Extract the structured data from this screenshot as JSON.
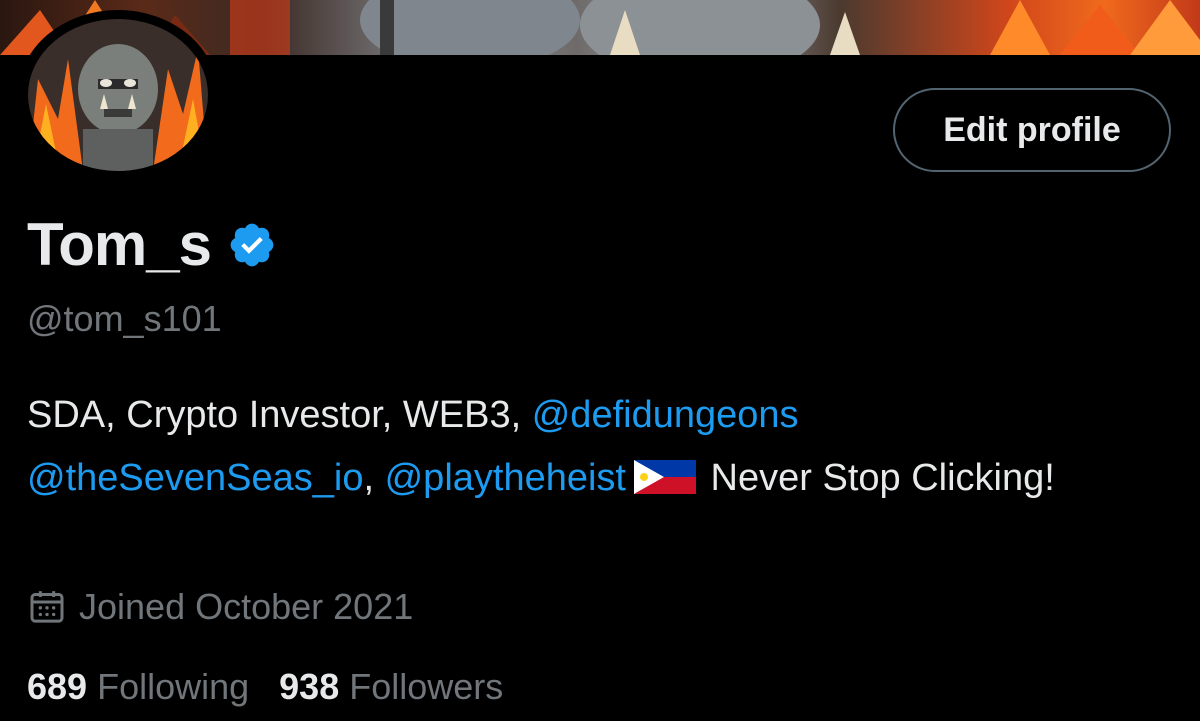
{
  "profile": {
    "display_name": "Tom_s",
    "handle": "@tom_s101",
    "edit_button_label": "Edit profile",
    "bio": {
      "text_1": "SDA, Crypto Investor, WEB3, ",
      "mention_1": "@defidungeons",
      "mention_2": "@theSevenSeas_io",
      "separator": ", ",
      "mention_3": "@playtheheist",
      "text_2": " Never Stop Clicking!"
    },
    "joined": "Joined October 2021",
    "stats": {
      "following_count": "689",
      "following_label": "Following",
      "followers_count": "938",
      "followers_label": "Followers"
    }
  },
  "icons": {
    "verified": "verified-badge-icon",
    "calendar": "calendar-icon",
    "flag": "philippines-flag-icon"
  },
  "colors": {
    "background": "#000000",
    "text": "#e7e9ea",
    "secondary_text": "#71767b",
    "accent": "#1d9bf0",
    "button_border": "#536471"
  }
}
